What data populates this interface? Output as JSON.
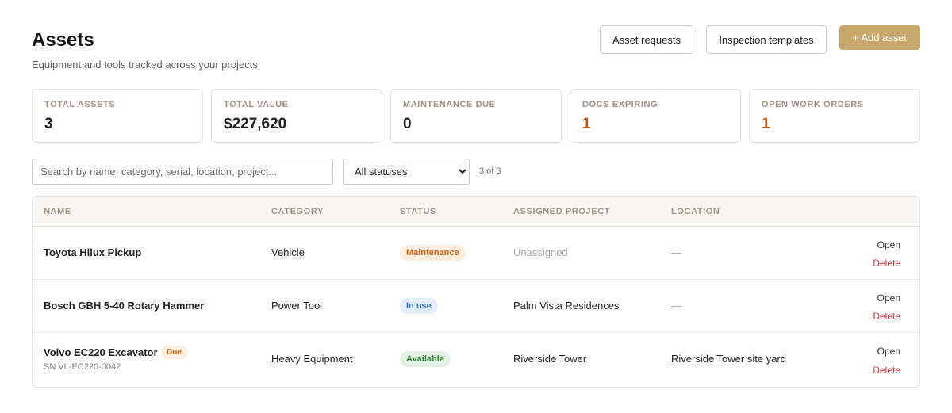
{
  "header": {
    "title": "Assets",
    "subtitle": "Equipment and tools tracked across your projects.",
    "asset_requests_label": "Asset requests",
    "inspection_templates_label": "Inspection templates",
    "add_asset_label": "+ Add asset"
  },
  "stats": [
    {
      "label": "TOTAL ASSETS",
      "value": "3"
    },
    {
      "label": "TOTAL VALUE",
      "value": "$227,620"
    },
    {
      "label": "MAINTENANCE DUE",
      "value": "0"
    },
    {
      "label": "DOCS EXPIRING",
      "value": "1"
    },
    {
      "label": "OPEN WORK ORDERS",
      "value": "1"
    }
  ],
  "filters": {
    "search_placeholder": "Search by name, category, serial, location, project...",
    "status_selected": "All statuses",
    "result_count": "3 of 3"
  },
  "table": {
    "columns": [
      "NAME",
      "CATEGORY",
      "STATUS",
      "ASSIGNED PROJECT",
      "LOCATION"
    ],
    "rows": [
      {
        "name": "Toyota Hilux Pickup",
        "category": "Vehicle",
        "status": "Maintenance",
        "project": "Unassigned",
        "location": "—",
        "open": "Open",
        "delete": "Delete"
      },
      {
        "name": "Bosch GBH 5-40 Rotary Hammer",
        "category": "Power Tool",
        "status": "In use",
        "project": "Palm Vista Residences",
        "location": "—",
        "open": "Open",
        "delete": "Delete"
      },
      {
        "name": "Volvo EC220 Excavator",
        "due_badge": "Due",
        "serial": "SN VL-EC220-0042",
        "category": "Heavy Equipment",
        "status": "Available",
        "project": "Riverside Tower",
        "location": "Riverside Tower site yard",
        "open": "Open",
        "delete": "Delete"
      }
    ]
  },
  "colors": {
    "accent": "#c8a96b",
    "alert": "#d4550d",
    "danger": "#d8343c"
  }
}
